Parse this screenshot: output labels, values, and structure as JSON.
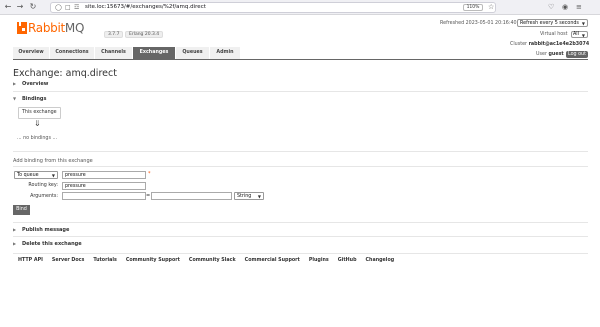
{
  "browser": {
    "url": "site.loc:15673/#/exchanges/%2f/amq.direct",
    "zoom": "110%"
  },
  "header": {
    "logo_brand": "Rabbit",
    "logo_suffix": "MQ",
    "version": "3.7.7",
    "erlang": "Erlang 20.3.4",
    "refreshed": "Refreshed 2023-05-01 20:16:40",
    "refresh_option": "Refresh every 5 seconds",
    "vhost_label": "Virtual host",
    "vhost_value": "All",
    "cluster_label": "Cluster",
    "cluster_value": "rabbit@ac1e4e2b3074",
    "user_label": "User",
    "user_value": "guest",
    "logout": "Log out"
  },
  "tabs": [
    {
      "label": "Overview"
    },
    {
      "label": "Connections"
    },
    {
      "label": "Channels"
    },
    {
      "label": "Exchanges"
    },
    {
      "label": "Queues"
    },
    {
      "label": "Admin"
    }
  ],
  "page": {
    "title_prefix": "Exchange:",
    "title_name": "amq.direct"
  },
  "sections": {
    "overview": "Overview",
    "bindings": "Bindings",
    "this_exchange": "This exchange",
    "no_bindings": "... no bindings ...",
    "add_binding_title": "Add binding from this exchange",
    "publish": "Publish message",
    "delete": "Delete this exchange"
  },
  "form": {
    "destination_type": "To queue",
    "destination_value": "pressure",
    "required_mark": "*",
    "routing_key_label": "Routing key:",
    "routing_key_value": "pressure",
    "arguments_label": "Arguments:",
    "arg_key": "",
    "equals": "=",
    "arg_value": "",
    "arg_type": "String",
    "bind_button": "Bind"
  },
  "footer": {
    "links": [
      "HTTP API",
      "Server Docs",
      "Tutorials",
      "Community Support",
      "Community Slack",
      "Commercial Support",
      "Plugins",
      "GitHub",
      "Changelog"
    ]
  }
}
